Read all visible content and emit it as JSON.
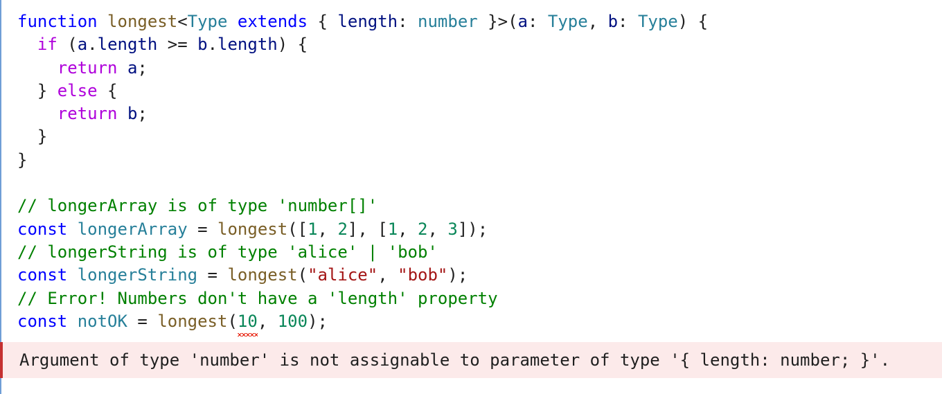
{
  "code": {
    "lines": [
      [
        {
          "t": "function",
          "c": "kw-blue"
        },
        {
          "t": " ",
          "c": "punc"
        },
        {
          "t": "longest",
          "c": "fn"
        },
        {
          "t": "<",
          "c": "punc"
        },
        {
          "t": "Type",
          "c": "type"
        },
        {
          "t": " ",
          "c": "punc"
        },
        {
          "t": "extends",
          "c": "kw-blue"
        },
        {
          "t": " { ",
          "c": "punc"
        },
        {
          "t": "length",
          "c": "var"
        },
        {
          "t": ": ",
          "c": "punc"
        },
        {
          "t": "number",
          "c": "type"
        },
        {
          "t": " }>(",
          "c": "punc"
        },
        {
          "t": "a",
          "c": "var"
        },
        {
          "t": ": ",
          "c": "punc"
        },
        {
          "t": "Type",
          "c": "type"
        },
        {
          "t": ", ",
          "c": "punc"
        },
        {
          "t": "b",
          "c": "var"
        },
        {
          "t": ": ",
          "c": "punc"
        },
        {
          "t": "Type",
          "c": "type"
        },
        {
          "t": ") {",
          "c": "punc"
        }
      ],
      [
        {
          "t": "  ",
          "c": "punc"
        },
        {
          "t": "if",
          "c": "kw-purple"
        },
        {
          "t": " (",
          "c": "punc"
        },
        {
          "t": "a",
          "c": "var"
        },
        {
          "t": ".",
          "c": "punc"
        },
        {
          "t": "length",
          "c": "var"
        },
        {
          "t": " >= ",
          "c": "punc"
        },
        {
          "t": "b",
          "c": "var"
        },
        {
          "t": ".",
          "c": "punc"
        },
        {
          "t": "length",
          "c": "var"
        },
        {
          "t": ") {",
          "c": "punc"
        }
      ],
      [
        {
          "t": "    ",
          "c": "punc"
        },
        {
          "t": "return",
          "c": "kw-purple"
        },
        {
          "t": " ",
          "c": "punc"
        },
        {
          "t": "a",
          "c": "var"
        },
        {
          "t": ";",
          "c": "punc"
        }
      ],
      [
        {
          "t": "  } ",
          "c": "punc"
        },
        {
          "t": "else",
          "c": "kw-purple"
        },
        {
          "t": " {",
          "c": "punc"
        }
      ],
      [
        {
          "t": "    ",
          "c": "punc"
        },
        {
          "t": "return",
          "c": "kw-purple"
        },
        {
          "t": " ",
          "c": "punc"
        },
        {
          "t": "b",
          "c": "var"
        },
        {
          "t": ";",
          "c": "punc"
        }
      ],
      [
        {
          "t": "  }",
          "c": "punc"
        }
      ],
      [
        {
          "t": "}",
          "c": "punc"
        }
      ],
      [],
      [
        {
          "t": "// longerArray is of type 'number[]'",
          "c": "cmt"
        }
      ],
      [
        {
          "t": "const",
          "c": "kw-blue"
        },
        {
          "t": " ",
          "c": "punc"
        },
        {
          "t": "longerArray",
          "c": "type"
        },
        {
          "t": " = ",
          "c": "punc"
        },
        {
          "t": "longest",
          "c": "fn"
        },
        {
          "t": "([",
          "c": "punc"
        },
        {
          "t": "1",
          "c": "num"
        },
        {
          "t": ", ",
          "c": "punc"
        },
        {
          "t": "2",
          "c": "num"
        },
        {
          "t": "], [",
          "c": "punc"
        },
        {
          "t": "1",
          "c": "num"
        },
        {
          "t": ", ",
          "c": "punc"
        },
        {
          "t": "2",
          "c": "num"
        },
        {
          "t": ", ",
          "c": "punc"
        },
        {
          "t": "3",
          "c": "num"
        },
        {
          "t": "]);",
          "c": "punc"
        }
      ],
      [
        {
          "t": "// longerString is of type 'alice' | 'bob'",
          "c": "cmt"
        }
      ],
      [
        {
          "t": "const",
          "c": "kw-blue"
        },
        {
          "t": " ",
          "c": "punc"
        },
        {
          "t": "longerString",
          "c": "type"
        },
        {
          "t": " = ",
          "c": "punc"
        },
        {
          "t": "longest",
          "c": "fn"
        },
        {
          "t": "(",
          "c": "punc"
        },
        {
          "t": "\"alice\"",
          "c": "str"
        },
        {
          "t": ", ",
          "c": "punc"
        },
        {
          "t": "\"bob\"",
          "c": "str"
        },
        {
          "t": ");",
          "c": "punc"
        }
      ],
      [
        {
          "t": "// Error! Numbers don't have a 'length' property",
          "c": "cmt"
        }
      ],
      [
        {
          "t": "const",
          "c": "kw-blue"
        },
        {
          "t": " ",
          "c": "punc"
        },
        {
          "t": "notOK",
          "c": "type"
        },
        {
          "t": " = ",
          "c": "punc"
        },
        {
          "t": "longest",
          "c": "fn"
        },
        {
          "t": "(",
          "c": "punc"
        },
        {
          "t": "10",
          "c": "num",
          "squiggle": true
        },
        {
          "t": ", ",
          "c": "punc"
        },
        {
          "t": "100",
          "c": "num"
        },
        {
          "t": ");",
          "c": "punc"
        }
      ]
    ]
  },
  "error": {
    "message": "Argument of type 'number' is not assignable to parameter of type '{ length: number; }'."
  },
  "colors": {
    "keyword_blue": "#0000ff",
    "keyword_purple": "#af00db",
    "function": "#795e26",
    "type": "#267f99",
    "variable": "#001080",
    "number": "#098658",
    "string": "#a31515",
    "comment": "#008000",
    "error_background": "#fceaea",
    "error_border": "#c53131",
    "squiggle": "#e51400"
  }
}
